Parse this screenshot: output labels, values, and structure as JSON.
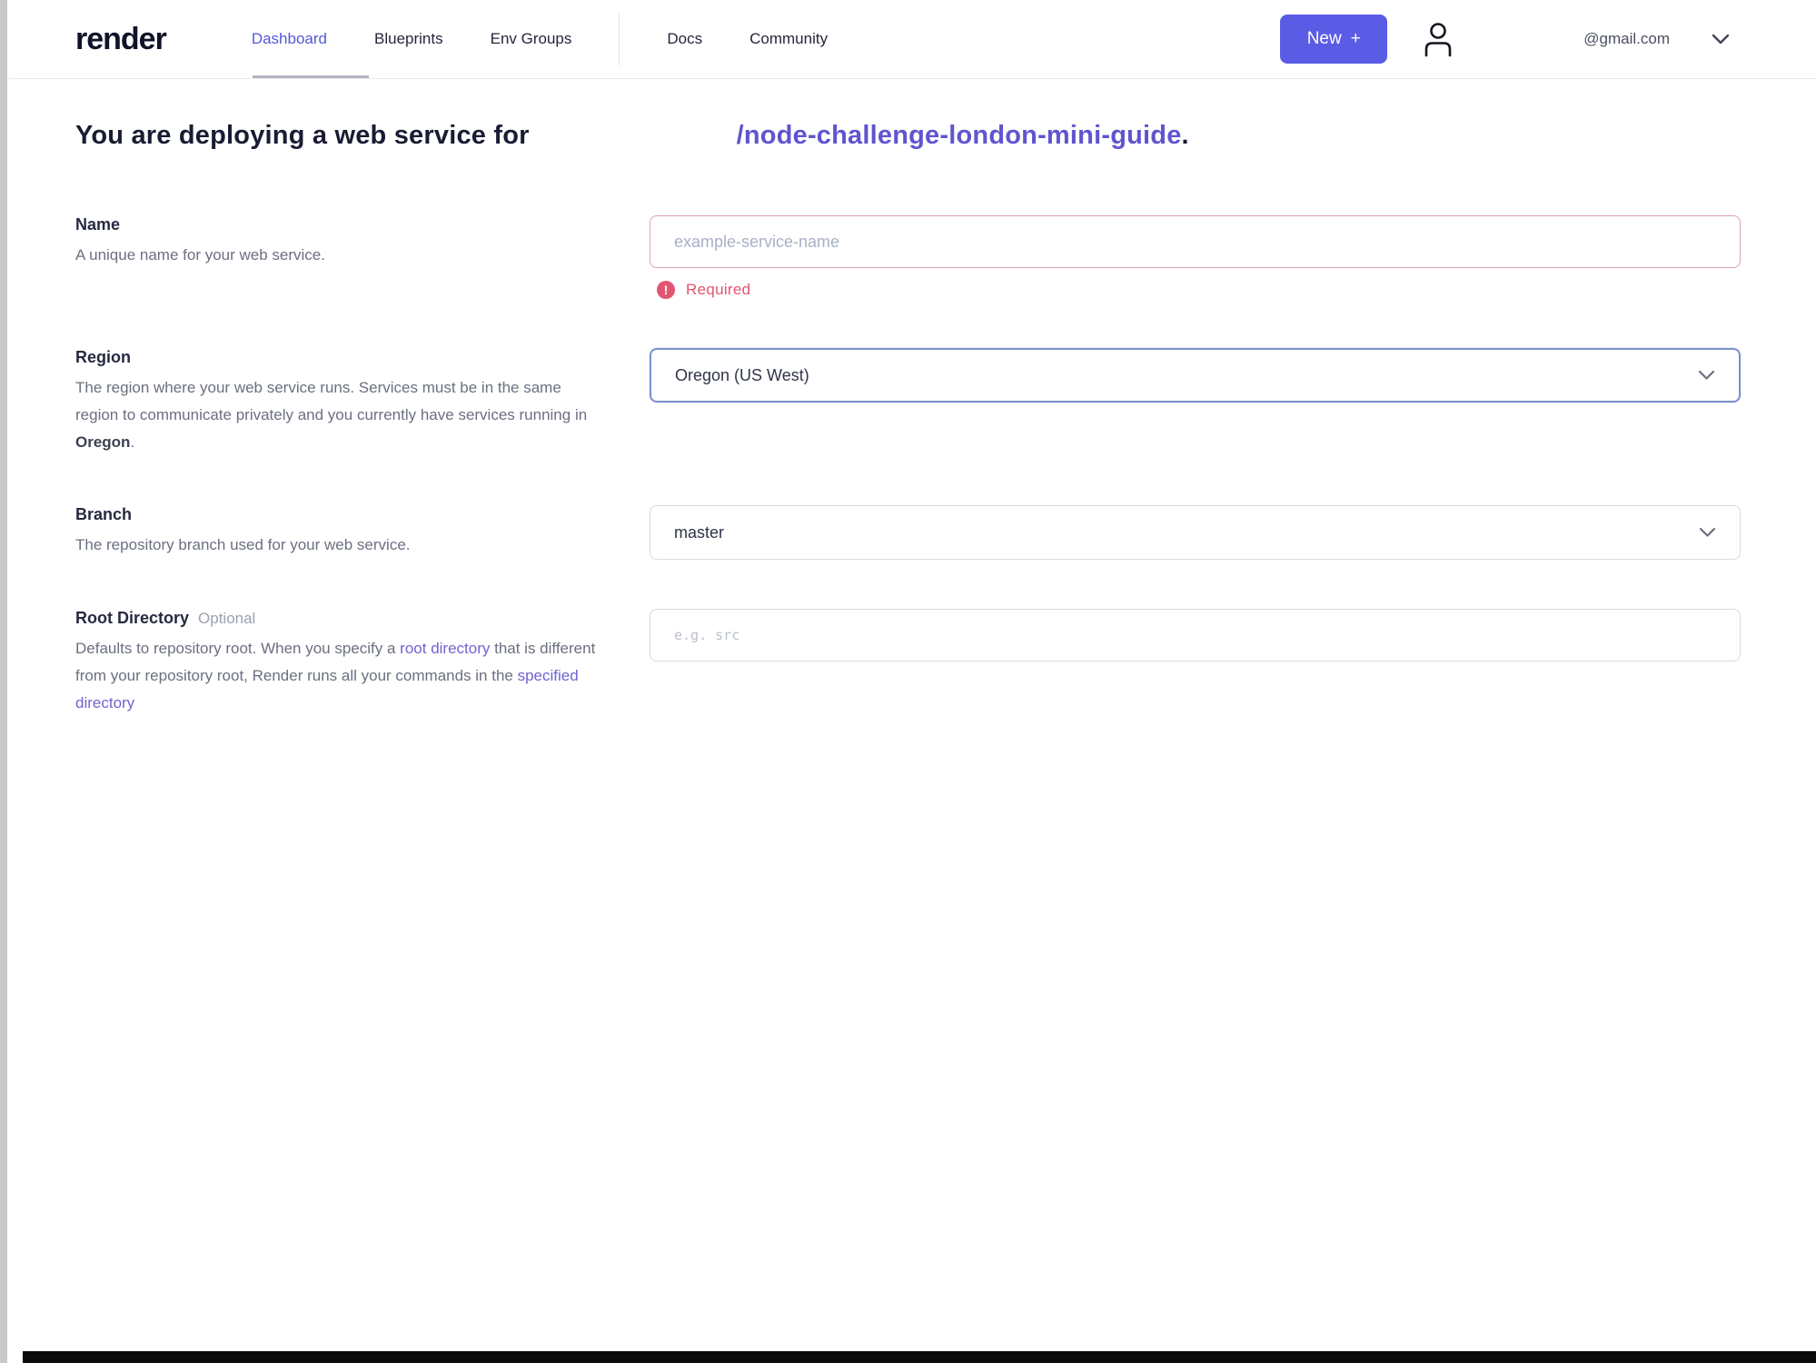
{
  "nav": {
    "logo": "render",
    "items": [
      {
        "label": "Dashboard",
        "active": true
      },
      {
        "label": "Blueprints",
        "active": false
      },
      {
        "label": "Env Groups",
        "active": false
      },
      {
        "label": "Docs",
        "active": false
      },
      {
        "label": "Community",
        "active": false
      }
    ],
    "new_button_label": "New",
    "new_button_icon": "+",
    "account_email": "@gmail.com",
    "icons": [
      "user-icon",
      "chevron-down-icon"
    ]
  },
  "heading": {
    "prefix": "You are deploying a web service for",
    "repo": "/node-challenge-london-mini-guide",
    "suffix": "."
  },
  "form": {
    "name": {
      "label": "Name",
      "description": "A unique name for your web service.",
      "placeholder": "example-service-name",
      "value": "",
      "error": "Required",
      "error_icon": "!"
    },
    "region": {
      "label": "Region",
      "desc_part1": "The region where your web service runs. Services must be in the same region to communicate privately and you currently have services running in ",
      "desc_bold": "Oregon",
      "desc_part2": ".",
      "value": "Oregon (US West)"
    },
    "branch": {
      "label": "Branch",
      "description": "The repository branch used for your web service.",
      "value": "master"
    },
    "root_directory": {
      "label": "Root Directory",
      "optional": "Optional",
      "desc_part1": "Defaults to repository root. When you specify a ",
      "link1": "root directory",
      "desc_part2": " that is different from your repository root, Render runs all your commands in the ",
      "link2": "specified directory",
      "placeholder": "e.g. src",
      "value": ""
    }
  },
  "colors": {
    "accent": "#5a5ce6",
    "active_nav": "#5558d6",
    "link": "#6f63d2",
    "repo_link": "#5f55cf",
    "error": "#e25571",
    "error_input_border": "#dba4b0",
    "focused_select_border": "#7c90cf",
    "label_text": "#262a41",
    "description_text": "#6b7080"
  }
}
